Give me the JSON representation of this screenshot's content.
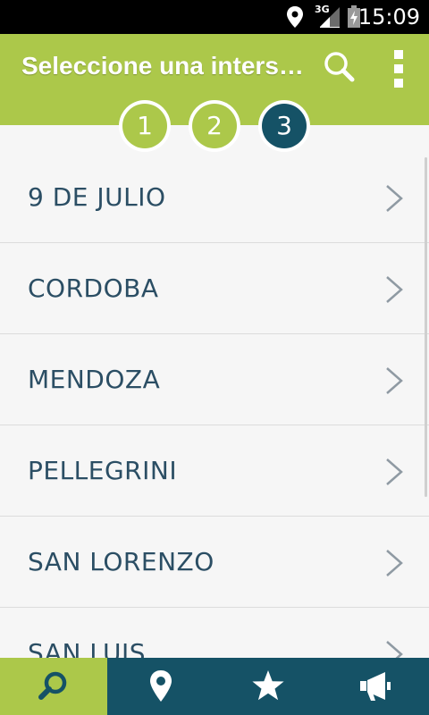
{
  "status_bar": {
    "time": "15:09",
    "network": "3G",
    "icons": [
      "location-icon",
      "signal-icon",
      "battery-icon"
    ]
  },
  "app_bar": {
    "title": "Seleccione una inters…",
    "background": "#acc84a",
    "icons": [
      "search-icon",
      "overflow-menu-icon"
    ]
  },
  "steps": [
    {
      "label": "1",
      "state": "done",
      "color": "#acc84a"
    },
    {
      "label": "2",
      "state": "done",
      "color": "#acc84a"
    },
    {
      "label": "3",
      "state": "current",
      "color": "#155266"
    }
  ],
  "list": {
    "items": [
      {
        "label": "9 DE JULIO"
      },
      {
        "label": "CORDOBA"
      },
      {
        "label": "MENDOZA"
      },
      {
        "label": "PELLEGRINI"
      },
      {
        "label": "SAN LORENZO"
      },
      {
        "label": "SAN LUIS"
      }
    ],
    "text_color": "#2b4e64"
  },
  "bottom_nav": {
    "background": "#155266",
    "active_color": "#acc84a",
    "items": [
      {
        "icon": "search-icon",
        "active": true
      },
      {
        "icon": "map-pin-icon",
        "active": false
      },
      {
        "icon": "star-icon",
        "active": false
      },
      {
        "icon": "megaphone-icon",
        "active": false
      }
    ]
  }
}
